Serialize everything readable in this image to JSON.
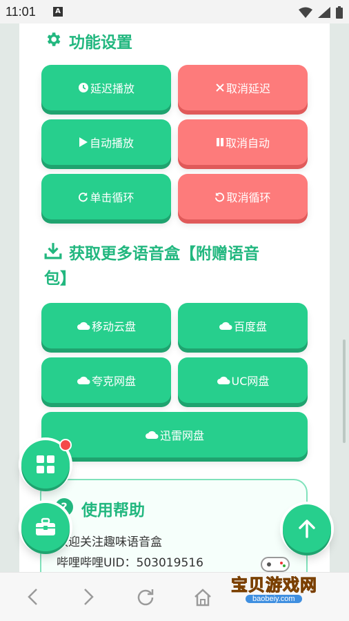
{
  "status": {
    "time": "11:01",
    "notif_letter": "A"
  },
  "section1": {
    "title": "功能设置",
    "icon": "gear-icon"
  },
  "buttons1": [
    {
      "label": "延迟播放",
      "icon": "clock-icon",
      "color": "green"
    },
    {
      "label": "取消延迟",
      "icon": "x-icon",
      "color": "red"
    },
    {
      "label": "自动播放",
      "icon": "play-icon",
      "color": "green"
    },
    {
      "label": "取消自动",
      "icon": "pause-icon",
      "color": "red"
    },
    {
      "label": "单击循环",
      "icon": "redo-icon",
      "color": "green"
    },
    {
      "label": "取消循环",
      "icon": "undo-icon",
      "color": "red"
    }
  ],
  "section2": {
    "title_line1": "获取更多语音盒【附赠语音",
    "title_line2": "包】",
    "icon": "download-icon"
  },
  "buttons2": [
    {
      "label": "移动云盘",
      "icon": "cloud-icon"
    },
    {
      "label": "百度盘",
      "icon": "cloud-icon"
    },
    {
      "label": "夸克网盘",
      "icon": "cloud-icon"
    },
    {
      "label": "UC网盘",
      "icon": "cloud-icon"
    },
    {
      "label": "迅雷网盘",
      "icon": "cloud-icon"
    }
  ],
  "help": {
    "title": "使用帮助",
    "line1": "欢迎关注趣味语音盒",
    "line2": "哔哩哔哩UID：503019516"
  },
  "watermark": {
    "text": "宝贝游戏网",
    "url": "baobeiy.com"
  },
  "colors": {
    "green": "#27cf8d",
    "red": "#fd7b7b",
    "title": "#22b77f"
  }
}
